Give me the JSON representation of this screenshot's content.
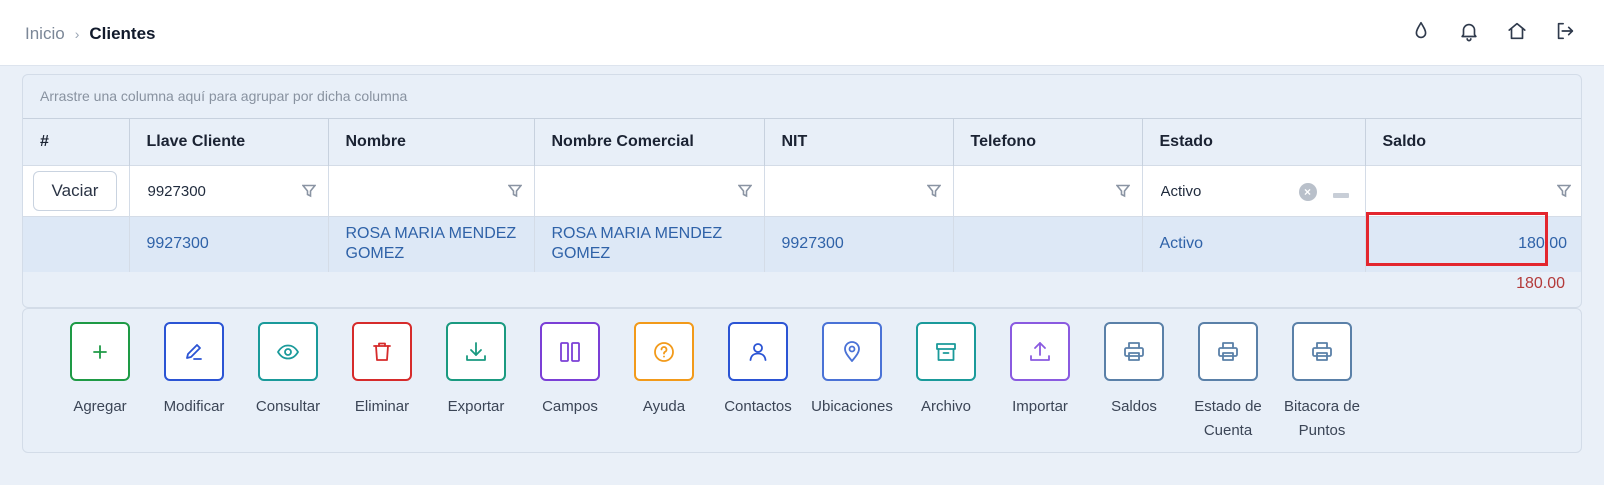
{
  "breadcrumb": {
    "home": "Inicio",
    "separator": "›",
    "current": "Clientes"
  },
  "top_icons": [
    "drop-icon",
    "bell-icon",
    "home-icon",
    "logout-icon"
  ],
  "grid": {
    "group_hint": "Arrastre una columna aquí para agrupar por dicha columna",
    "columns": [
      "#",
      "Llave Cliente",
      "Nombre",
      "Nombre Comercial",
      "NIT",
      "Telefono",
      "Estado",
      "Saldo"
    ],
    "filters": {
      "clear_button": "Vaciar",
      "llave_cliente": "9927300",
      "nombre": "",
      "nombre_comercial": "",
      "nit": "",
      "telefono": "",
      "estado": "Activo",
      "saldo": ""
    },
    "rows": [
      {
        "num": "",
        "llave_cliente": "9927300",
        "nombre": "ROSA MARIA MENDEZ GOMEZ",
        "nombre_comercial": "ROSA MARIA MENDEZ GOMEZ",
        "nit": "9927300",
        "telefono": "",
        "estado": "Activo",
        "saldo": "180.00"
      }
    ],
    "total_saldo": "180.00"
  },
  "toolbar": [
    {
      "label": "Agregar",
      "icon": "plus-icon",
      "color": "#1e9a45"
    },
    {
      "label": "Modificar",
      "icon": "pencil-icon",
      "color": "#2b54d4"
    },
    {
      "label": "Consultar",
      "icon": "eye-icon",
      "color": "#1a9a9a"
    },
    {
      "label": "Eliminar",
      "icon": "trash-icon",
      "color": "#d62b2b"
    },
    {
      "label": "Exportar",
      "icon": "download-icon",
      "color": "#1a9a80"
    },
    {
      "label": "Campos",
      "icon": "columns-icon",
      "color": "#7b3fd6"
    },
    {
      "label": "Ayuda",
      "icon": "help-icon",
      "color": "#f29a1a"
    },
    {
      "label": "Contactos",
      "icon": "user-icon",
      "color": "#2b54d4"
    },
    {
      "label": "Ubicaciones",
      "icon": "location-icon",
      "color": "#4a72d6"
    },
    {
      "label": "Archivo",
      "icon": "archive-icon",
      "color": "#1a9a9a"
    },
    {
      "label": "Importar",
      "icon": "upload-icon",
      "color": "#8a5ae0"
    },
    {
      "label": "Saldos",
      "icon": "printer-icon",
      "color": "#5a80a8"
    },
    {
      "label": "Estado de Cuenta",
      "icon": "printer-icon",
      "color": "#5a80a8"
    },
    {
      "label": "Bitacora de Puntos",
      "icon": "printer-icon",
      "color": "#5a80a8"
    }
  ]
}
